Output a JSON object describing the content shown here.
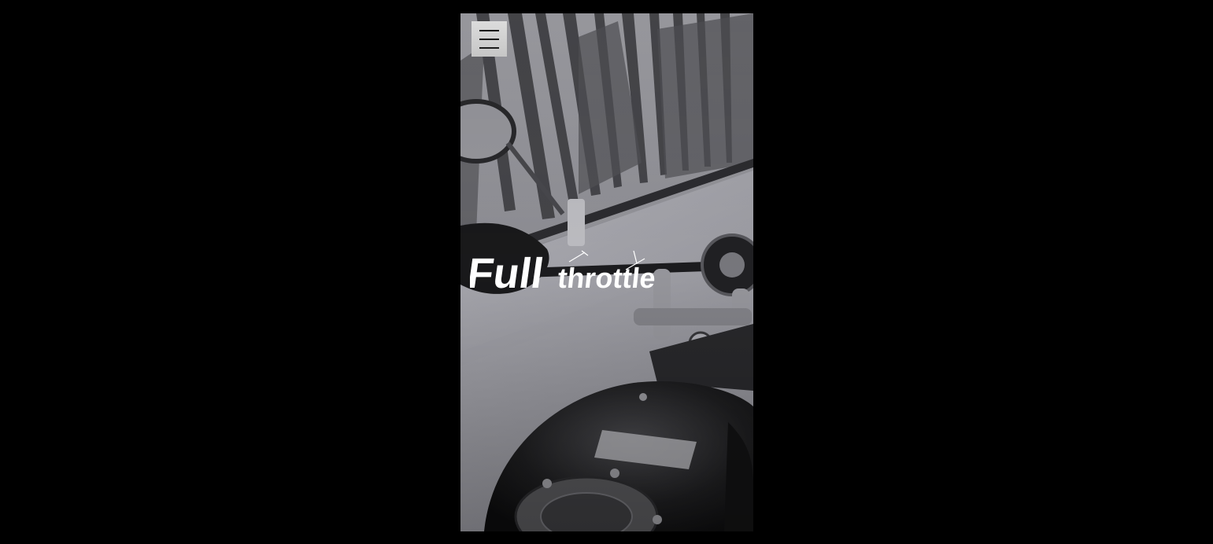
{
  "hero": {
    "logo_text_main": "Full",
    "logo_text_secondary": "throttle"
  },
  "menu": {
    "button_icon": "hamburger-icon"
  },
  "colors": {
    "page_background": "#000000",
    "menu_button_bg": "#d2d2d2",
    "logo_text": "#ffffff"
  }
}
